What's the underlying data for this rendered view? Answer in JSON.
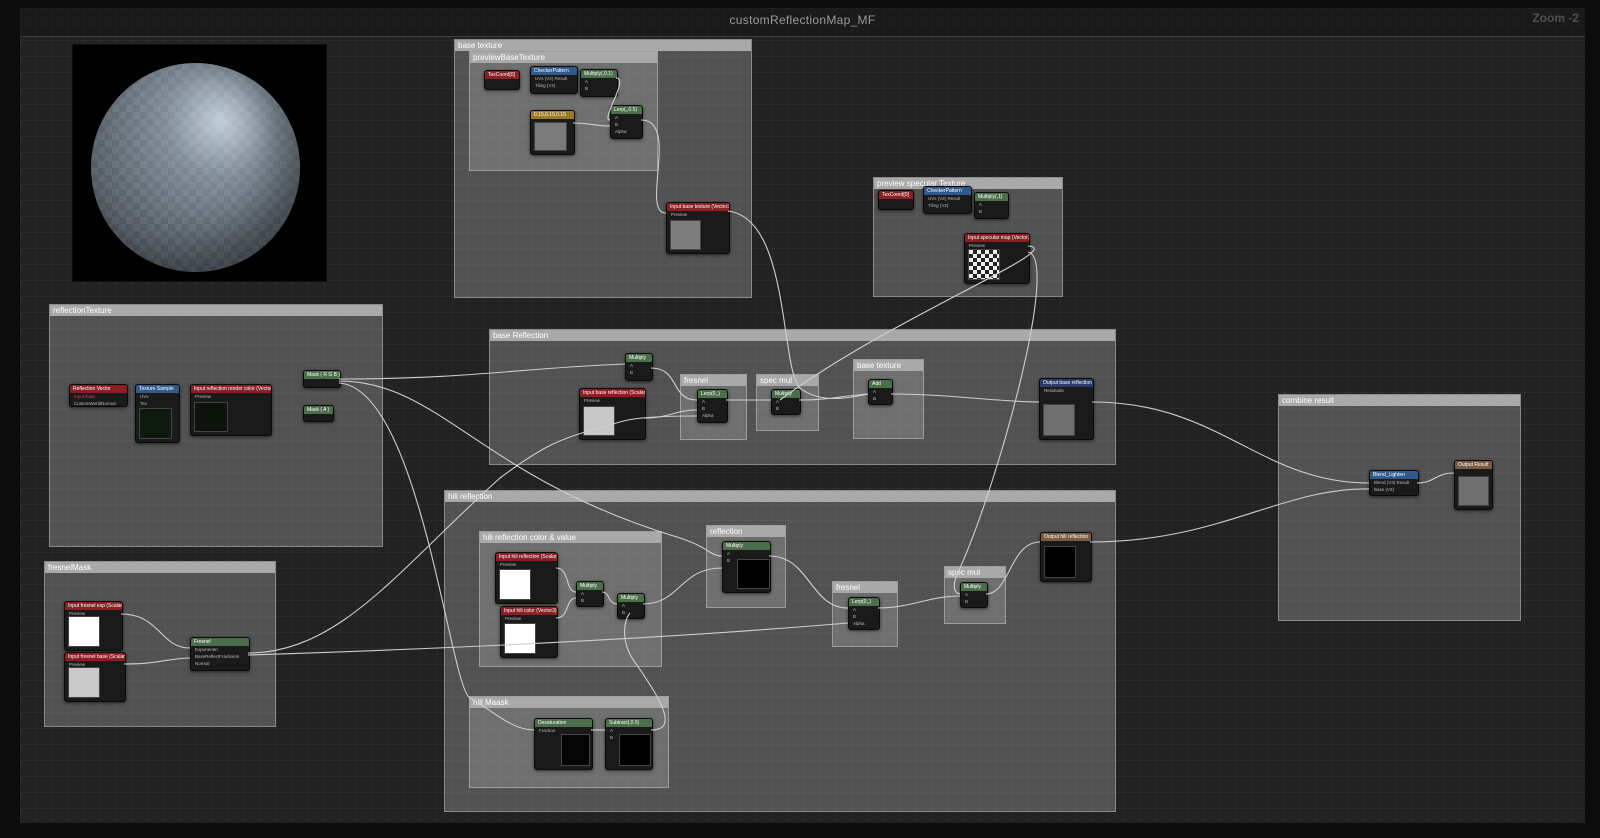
{
  "window": {
    "title": "customReflectionMap_MF",
    "zoom": "Zoom -2"
  },
  "groups": {
    "base_texture": "base texture",
    "preview_base_texture": "previewBaseTexture",
    "preview_specular_texture": "preview specular Texture",
    "reflection_texture": "reflectionTexture",
    "base_reflection": "base Reflection",
    "fresnel": "fresnel",
    "spec_mul": "spec mul",
    "base_texture_inner": "base texture",
    "combine_result": "combine result",
    "hili_reflection": "hili reflection",
    "hili_reflection_color": "hili reflection color & value",
    "reflection": "reflection",
    "fresnel2": "fresnel",
    "spec_mul2": "spec mul",
    "hili_mask": "hili Maask",
    "fresnel_mask": "fresnelMask"
  },
  "nodes": {
    "texcoord1": "TexCoord[0]",
    "checker1": "CheckerPattern",
    "checker1_uvs": "UVs (V2)",
    "checker1_result": "Result",
    "checker1_tiling": "Tiling (V2)",
    "mul1": "Multiply(,0.1)",
    "mul1_a": "A",
    "mul1_b": "B",
    "const1": "0.15,0.15,0.15",
    "lerp1": "Lerp(,,0.5)",
    "lerp1_a": "A",
    "lerp1_b": "B",
    "lerp1_alpha": "Alpha",
    "input_base_tex": "Input base texture (Vector3)",
    "input_base_tex_preview": "Preview",
    "texcoord2": "TexCoord[0]",
    "checker2": "CheckerPattern",
    "checker2_uvs": "UVs (V2)",
    "checker2_result": "Result",
    "checker2_tiling": "Tiling (V2)",
    "mul2": "Multiply(,1)",
    "mul2_a": "A",
    "mul2_b": "B",
    "input_spec": "Input specular map (Vector3)",
    "input_spec_preview": "Preview",
    "refl_vector": "Reflection Vector",
    "refl_vector_sub": "Input Data",
    "refl_vector_pin": "CustomWorldNormal",
    "tex_sample": "Texture Sample",
    "tex_sample_uvs": "UVs",
    "tex_sample_tex": "Tex",
    "input_refl_color": "Input reflection render color (Vector3)",
    "input_refl_color_preview": "Preview",
    "mask_rgb": "Mask ( R G B )",
    "mask_a": "Mask ( A )",
    "mul3": "Multiply",
    "mul3_a": "A",
    "mul3_b": "B",
    "input_base_refl": "Input base reflection (Scalar)",
    "input_base_refl_preview": "Preview",
    "lerp2": "Lerp(0,,)",
    "lerp2_a": "A",
    "lerp2_b": "B",
    "lerp2_alpha": "Alpha",
    "mul4": "Multiply",
    "mul4_a": "A",
    "mul4_b": "B",
    "add1": "Add",
    "add1_a": "A",
    "add1_b": "B",
    "output_base_refl": "Output base reflection",
    "output_base_refl_pin": "Residuals",
    "blend_lighten": "Blend_Lighten",
    "blend_pin": "Blend (V3)",
    "blend_result": "Result",
    "base_pin": "Base (V3)",
    "output_result": "Output Result",
    "input_hili_refl": "Input hili reflection (Scalar)",
    "input_hili_refl_preview": "Preview",
    "input_hili_color": "Input hili color (Vector3)",
    "input_hili_color_preview": "Preview",
    "mul5": "Multiply",
    "mul5_a": "A",
    "mul5_b": "B",
    "mul6": "Multiply",
    "mul6_a": "A",
    "mul6_b": "B",
    "mul7": "Multiply",
    "mul7_a": "A",
    "mul7_b": "B",
    "lerp3": "Lerp(0,,)",
    "lerp3_a": "A",
    "lerp3_b": "B",
    "lerp3_alpha": "Alpha",
    "mul8": "Multiply",
    "mul8_a": "A",
    "mul8_b": "B",
    "output_hili_refl": "Output hili reflection",
    "desaturation": "Desaturation",
    "desat_fraction": "Fraction",
    "subtract": "Subtract(,0.5)",
    "subtract_a": "A",
    "subtract_b": "B",
    "input_fresnel_exp": "Input fresnel exp (Scalar)",
    "input_fresnel_exp_preview": "Preview",
    "input_fresnel_base": "Input fresnel base (Scalar)",
    "input_fresnel_base_preview": "Preview",
    "fresnel": "Fresnel",
    "fresnel_exp": "ExponentIn",
    "fresnel_base": "BaseReflectFractionIn",
    "fresnel_normal": "Normal"
  },
  "colors": {
    "header_red": "#8a1f24",
    "header_green": "#4b6e4b",
    "header_blue": "#305a8c",
    "header_yellow": "#9c7a25",
    "header_navy": "#2c3b6a",
    "wire": "#d0d0d0"
  }
}
